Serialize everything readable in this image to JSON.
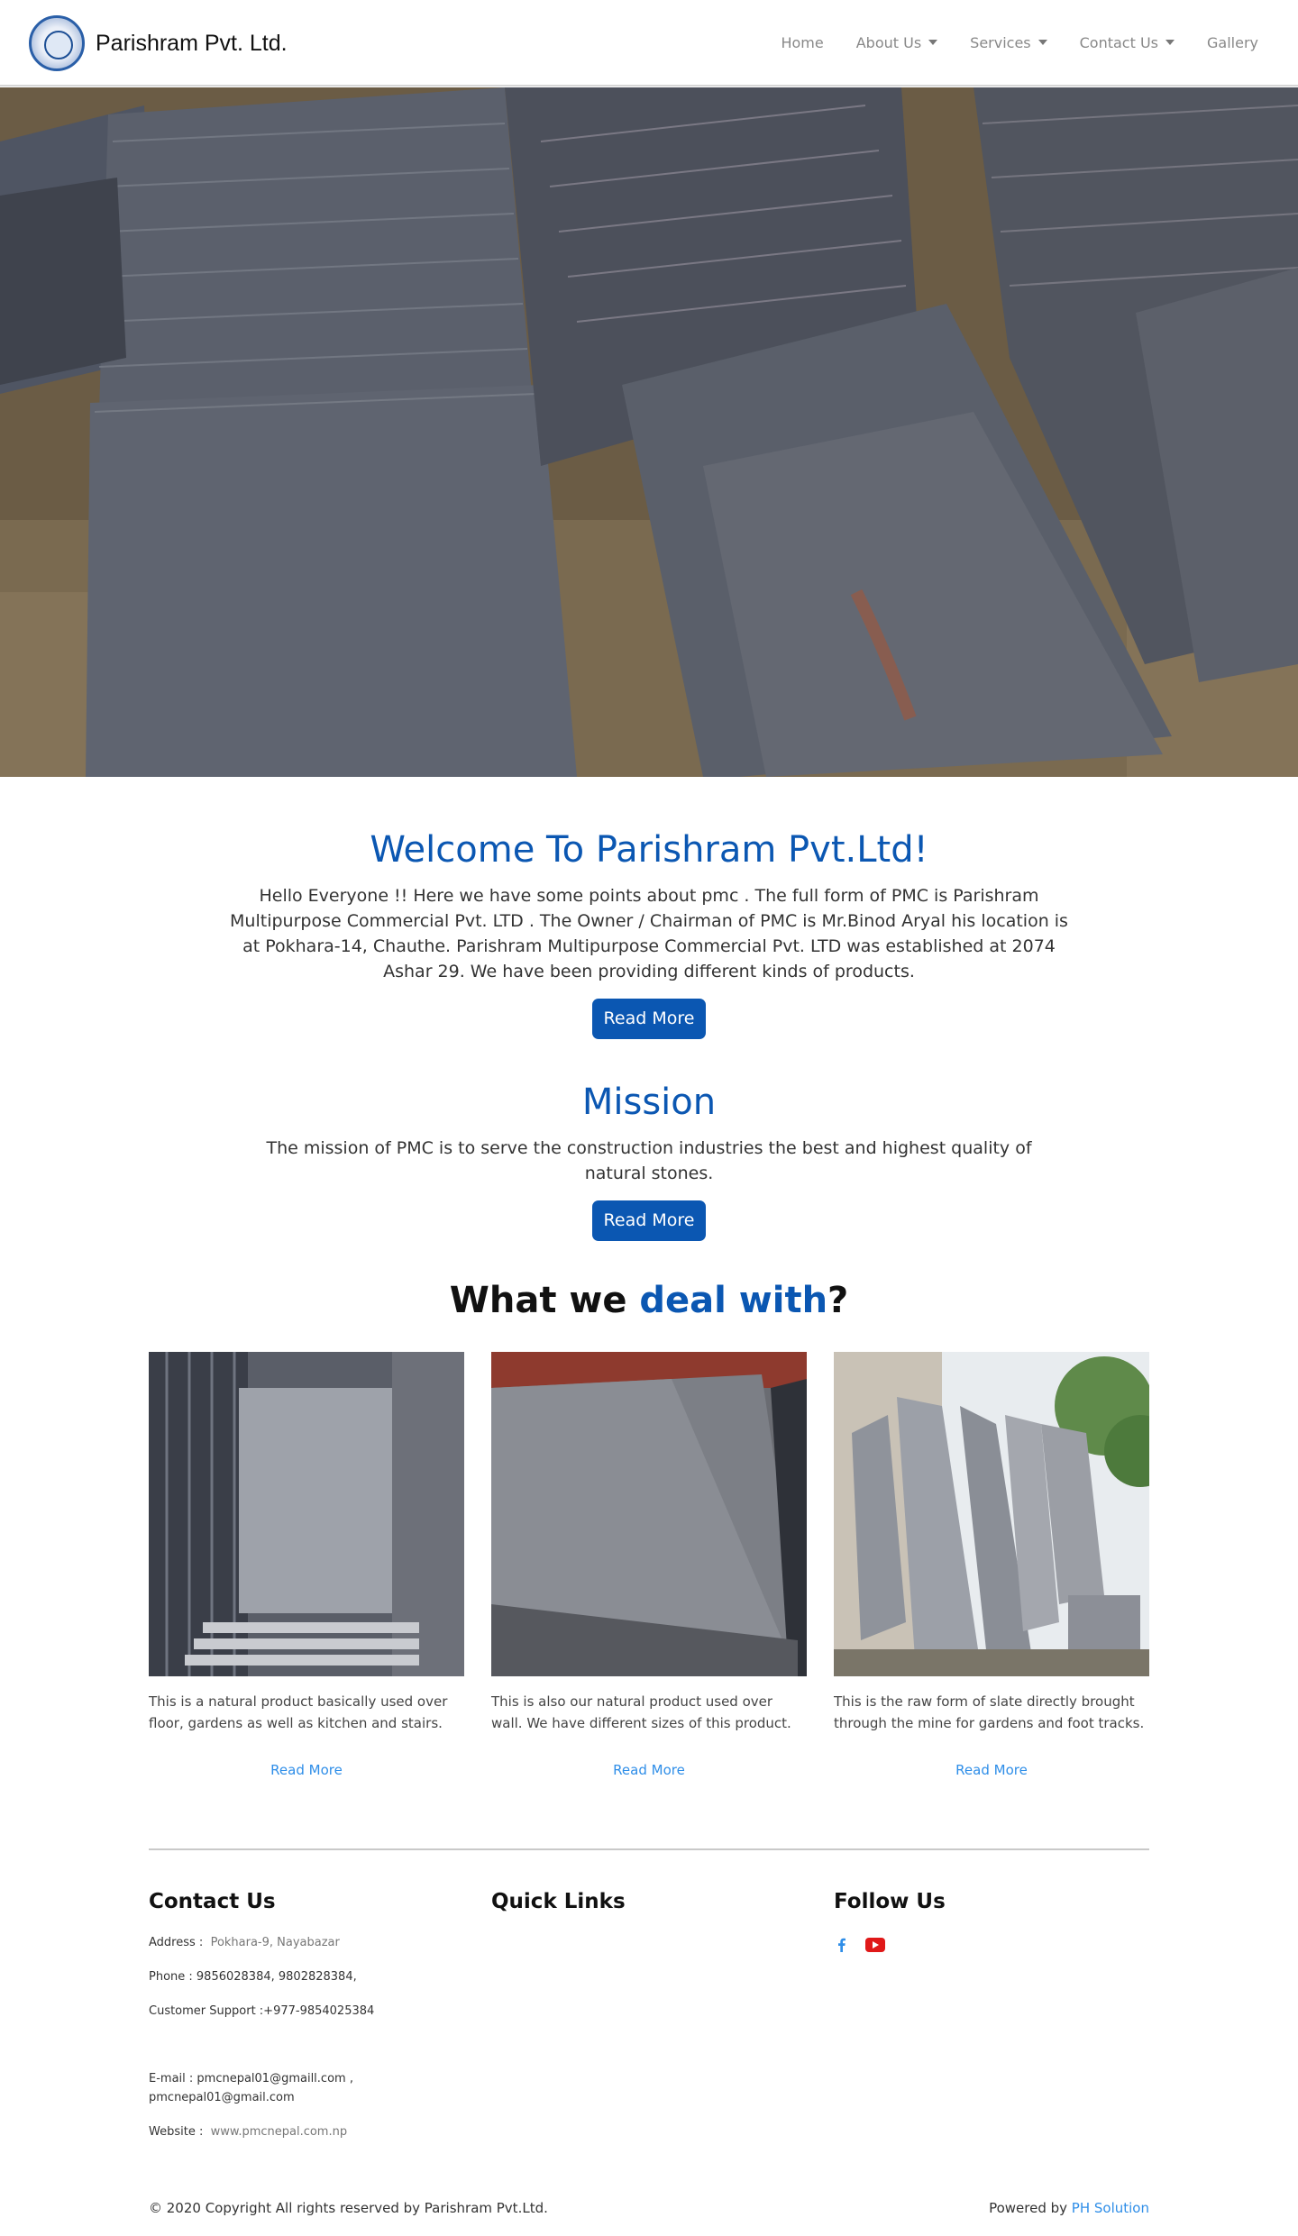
{
  "nav": {
    "brand": "Parishram Pvt. Ltd.",
    "items": [
      {
        "label": "Home",
        "dropdown": false
      },
      {
        "label": "About Us",
        "dropdown": true
      },
      {
        "label": "Services",
        "dropdown": true
      },
      {
        "label": "Contact Us",
        "dropdown": true
      },
      {
        "label": "Gallery",
        "dropdown": false
      }
    ]
  },
  "welcome": {
    "title": "Welcome To Parishram Pvt.Ltd!",
    "text": "Hello Everyone !! Here we have some points about pmc . The full form of PMC is Parishram Multipurpose Commercial Pvt. LTD . The Owner / Chairman of PMC is Mr.Binod Aryal his location is at Pokhara-14, Chauthe. Parishram Multipurpose Commercial Pvt. LTD was established at 2074 Ashar 29. We have been providing different kinds of products.",
    "button": "Read More"
  },
  "mission": {
    "title": "Mission",
    "text": "The mission of PMC is to serve the construction industries the best and highest quality of natural stones.",
    "button": "Read More"
  },
  "deal": {
    "title_prefix": "What we ",
    "title_highlight": "deal with",
    "title_suffix": "?",
    "cards": [
      {
        "text": "This is a natural product basically used over floor, gardens as well as kitchen and stairs.",
        "link": "Read More"
      },
      {
        "text": "This is also our natural product used over wall. We have different sizes of this product.",
        "link": "Read More"
      },
      {
        "text": "This is the raw form of slate directly brought through the mine for gardens and foot tracks.",
        "link": "Read More"
      }
    ]
  },
  "footer": {
    "contact_heading": "Contact Us",
    "quick_links_heading": "Quick Links",
    "follow_heading": "Follow Us",
    "address_label": "Address :",
    "address_value": "Pokhara-9, Nayabazar",
    "phone": "Phone : 9856028384, 9802828384,",
    "support": "Customer Support :+977-9854025384",
    "email_line1": "E-mail : pmcnepal01@gmaill.com ,",
    "email_line2": "pmcnepal01@gmail.com",
    "website_label": "Website :",
    "website_value": "www.pmcnepal.com.np",
    "copyright": "© 2020 Copyright All rights reserved by Parishram Pvt.Ltd.",
    "powered_prefix": "Powered by ",
    "powered_link": "PH Solution"
  },
  "colors": {
    "accent": "#0b57b2",
    "link": "#2f8ee8",
    "youtube": "#e01919"
  }
}
